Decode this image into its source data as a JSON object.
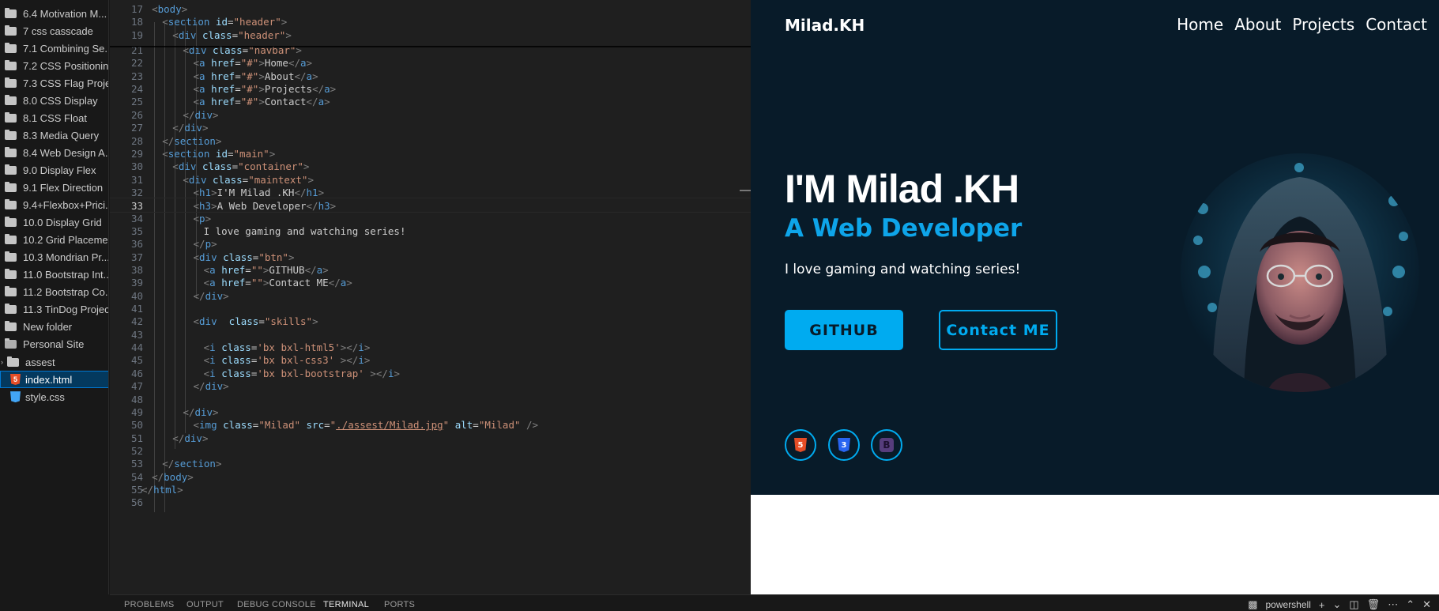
{
  "explorer": {
    "items": [
      {
        "label": "6.4 Motivation M...",
        "kind": "folder"
      },
      {
        "label": "7 css casscade",
        "kind": "folder"
      },
      {
        "label": "7.1 Combining Se...",
        "kind": "folder"
      },
      {
        "label": "7.2 CSS Positioning",
        "kind": "folder"
      },
      {
        "label": "7.3 CSS Flag Project",
        "kind": "folder"
      },
      {
        "label": "8.0 CSS Display",
        "kind": "folder"
      },
      {
        "label": "8.1 CSS Float",
        "kind": "folder"
      },
      {
        "label": "8.3 Media Query",
        "kind": "folder"
      },
      {
        "label": "8.4 Web Design A...",
        "kind": "folder"
      },
      {
        "label": "9.0 Display Flex",
        "kind": "folder"
      },
      {
        "label": "9.1 Flex Direction",
        "kind": "folder"
      },
      {
        "label": "9.4+Flexbox+Prici...",
        "kind": "folder"
      },
      {
        "label": "10.0 Display Grid",
        "kind": "folder"
      },
      {
        "label": "10.2 Grid Placeme...",
        "kind": "folder"
      },
      {
        "label": "10.3 Mondrian Pr...",
        "kind": "folder"
      },
      {
        "label": "11.0 Bootstrap Int...",
        "kind": "folder"
      },
      {
        "label": "11.2 Bootstrap Co...",
        "kind": "folder"
      },
      {
        "label": "11.3 TinDog Project",
        "kind": "folder"
      },
      {
        "label": "New folder",
        "kind": "folder"
      },
      {
        "label": "Personal Site",
        "kind": "folder-open"
      },
      {
        "label": "assest",
        "kind": "subfolder"
      },
      {
        "label": "index.html",
        "kind": "html-file",
        "selected": true
      },
      {
        "label": "style.css",
        "kind": "css-file"
      }
    ]
  },
  "editor": {
    "active_line": 33,
    "lines": [
      {
        "n": "17",
        "indent": 1,
        "tokens": [
          [
            "p",
            "<"
          ],
          [
            "t",
            "body"
          ],
          [
            "p",
            ">"
          ]
        ]
      },
      {
        "n": "18",
        "indent": 2,
        "tokens": [
          [
            "p",
            "<"
          ],
          [
            "t",
            "section"
          ],
          [
            "x",
            " "
          ],
          [
            "a",
            "id"
          ],
          [
            "x",
            "="
          ],
          [
            "s",
            "\"header\""
          ],
          [
            "p",
            ">"
          ]
        ]
      },
      {
        "n": "19",
        "indent": 3,
        "tokens": [
          [
            "p",
            "<"
          ],
          [
            "t",
            "div"
          ],
          [
            "x",
            " "
          ],
          [
            "a",
            "class"
          ],
          [
            "x",
            "="
          ],
          [
            "s",
            "\"header\""
          ],
          [
            "p",
            ">"
          ]
        ]
      },
      {
        "n": "21",
        "indent": 4,
        "tokens": [
          [
            "p",
            "<"
          ],
          [
            "t",
            "div"
          ],
          [
            "x",
            " "
          ],
          [
            "a",
            "class"
          ],
          [
            "x",
            "="
          ],
          [
            "s",
            "\"navbar\""
          ],
          [
            "p",
            ">"
          ]
        ]
      },
      {
        "n": "22",
        "indent": 5,
        "tokens": [
          [
            "p",
            "<"
          ],
          [
            "t",
            "a"
          ],
          [
            "x",
            " "
          ],
          [
            "a",
            "href"
          ],
          [
            "x",
            "="
          ],
          [
            "s",
            "\"#\""
          ],
          [
            "p",
            ">"
          ],
          [
            "x",
            "Home"
          ],
          [
            "p",
            "</"
          ],
          [
            "t",
            "a"
          ],
          [
            "p",
            ">"
          ]
        ]
      },
      {
        "n": "23",
        "indent": 5,
        "tokens": [
          [
            "p",
            "<"
          ],
          [
            "t",
            "a"
          ],
          [
            "x",
            " "
          ],
          [
            "a",
            "href"
          ],
          [
            "x",
            "="
          ],
          [
            "s",
            "\"#\""
          ],
          [
            "p",
            ">"
          ],
          [
            "x",
            "About"
          ],
          [
            "p",
            "</"
          ],
          [
            "t",
            "a"
          ],
          [
            "p",
            ">"
          ]
        ]
      },
      {
        "n": "24",
        "indent": 5,
        "tokens": [
          [
            "p",
            "<"
          ],
          [
            "t",
            "a"
          ],
          [
            "x",
            " "
          ],
          [
            "a",
            "href"
          ],
          [
            "x",
            "="
          ],
          [
            "s",
            "\"#\""
          ],
          [
            "p",
            ">"
          ],
          [
            "x",
            "Projects"
          ],
          [
            "p",
            "</"
          ],
          [
            "t",
            "a"
          ],
          [
            "p",
            ">"
          ]
        ]
      },
      {
        "n": "25",
        "indent": 5,
        "tokens": [
          [
            "p",
            "<"
          ],
          [
            "t",
            "a"
          ],
          [
            "x",
            " "
          ],
          [
            "a",
            "href"
          ],
          [
            "x",
            "="
          ],
          [
            "s",
            "\"#\""
          ],
          [
            "p",
            ">"
          ],
          [
            "x",
            "Contact"
          ],
          [
            "p",
            "</"
          ],
          [
            "t",
            "a"
          ],
          [
            "p",
            ">"
          ]
        ]
      },
      {
        "n": "26",
        "indent": 4,
        "tokens": [
          [
            "p",
            "</"
          ],
          [
            "t",
            "div"
          ],
          [
            "p",
            ">"
          ]
        ]
      },
      {
        "n": "27",
        "indent": 3,
        "tokens": [
          [
            "p",
            "</"
          ],
          [
            "t",
            "div"
          ],
          [
            "p",
            ">"
          ]
        ]
      },
      {
        "n": "28",
        "indent": 2,
        "tokens": [
          [
            "p",
            "</"
          ],
          [
            "t",
            "section"
          ],
          [
            "p",
            ">"
          ]
        ]
      },
      {
        "n": "29",
        "indent": 2,
        "tokens": [
          [
            "p",
            "<"
          ],
          [
            "t",
            "section"
          ],
          [
            "x",
            " "
          ],
          [
            "a",
            "id"
          ],
          [
            "x",
            "="
          ],
          [
            "s",
            "\"main\""
          ],
          [
            "p",
            ">"
          ]
        ]
      },
      {
        "n": "30",
        "indent": 3,
        "tokens": [
          [
            "p",
            "<"
          ],
          [
            "t",
            "div"
          ],
          [
            "x",
            " "
          ],
          [
            "a",
            "class"
          ],
          [
            "x",
            "="
          ],
          [
            "s",
            "\"container\""
          ],
          [
            "p",
            ">"
          ]
        ]
      },
      {
        "n": "31",
        "indent": 4,
        "tokens": [
          [
            "p",
            "<"
          ],
          [
            "t",
            "div"
          ],
          [
            "x",
            " "
          ],
          [
            "a",
            "class"
          ],
          [
            "x",
            "="
          ],
          [
            "s",
            "\"maintext\""
          ],
          [
            "p",
            ">"
          ]
        ]
      },
      {
        "n": "32",
        "indent": 5,
        "tokens": [
          [
            "p",
            "<"
          ],
          [
            "t",
            "h1"
          ],
          [
            "p",
            ">"
          ],
          [
            "x",
            "I'M Milad .KH"
          ],
          [
            "p",
            "</"
          ],
          [
            "t",
            "h1"
          ],
          [
            "p",
            ">"
          ]
        ]
      },
      {
        "n": "33",
        "indent": 5,
        "tokens": [
          [
            "p",
            "<"
          ],
          [
            "t",
            "h3"
          ],
          [
            "p",
            ">"
          ],
          [
            "x",
            "A Web Developer"
          ],
          [
            "p",
            "</"
          ],
          [
            "t",
            "h3"
          ],
          [
            "p",
            ">"
          ]
        ]
      },
      {
        "n": "34",
        "indent": 5,
        "tokens": [
          [
            "p",
            "<"
          ],
          [
            "t",
            "p"
          ],
          [
            "p",
            ">"
          ]
        ]
      },
      {
        "n": "35",
        "indent": 6,
        "tokens": [
          [
            "x",
            "I love gaming and watching series!"
          ]
        ]
      },
      {
        "n": "36",
        "indent": 5,
        "tokens": [
          [
            "p",
            "</"
          ],
          [
            "t",
            "p"
          ],
          [
            "p",
            ">"
          ]
        ]
      },
      {
        "n": "37",
        "indent": 5,
        "tokens": [
          [
            "p",
            "<"
          ],
          [
            "t",
            "div"
          ],
          [
            "x",
            " "
          ],
          [
            "a",
            "class"
          ],
          [
            "x",
            "="
          ],
          [
            "s",
            "\"btn\""
          ],
          [
            "p",
            ">"
          ]
        ]
      },
      {
        "n": "38",
        "indent": 6,
        "tokens": [
          [
            "p",
            "<"
          ],
          [
            "t",
            "a"
          ],
          [
            "x",
            " "
          ],
          [
            "a",
            "href"
          ],
          [
            "x",
            "="
          ],
          [
            "s",
            "\"\""
          ],
          [
            "p",
            ">"
          ],
          [
            "x",
            "GITHUB"
          ],
          [
            "p",
            "</"
          ],
          [
            "t",
            "a"
          ],
          [
            "p",
            ">"
          ]
        ]
      },
      {
        "n": "39",
        "indent": 6,
        "tokens": [
          [
            "p",
            "<"
          ],
          [
            "t",
            "a"
          ],
          [
            "x",
            " "
          ],
          [
            "a",
            "href"
          ],
          [
            "x",
            "="
          ],
          [
            "s",
            "\"\""
          ],
          [
            "p",
            ">"
          ],
          [
            "x",
            "Contact ME"
          ],
          [
            "p",
            "</"
          ],
          [
            "t",
            "a"
          ],
          [
            "p",
            ">"
          ]
        ]
      },
      {
        "n": "40",
        "indent": 5,
        "tokens": [
          [
            "p",
            "</"
          ],
          [
            "t",
            "div"
          ],
          [
            "p",
            ">"
          ]
        ]
      },
      {
        "n": "41",
        "indent": 0,
        "tokens": []
      },
      {
        "n": "42",
        "indent": 5,
        "tokens": [
          [
            "p",
            "<"
          ],
          [
            "t",
            "div"
          ],
          [
            "x",
            "  "
          ],
          [
            "a",
            "class"
          ],
          [
            "x",
            "="
          ],
          [
            "s",
            "\"skills\""
          ],
          [
            "p",
            ">"
          ]
        ]
      },
      {
        "n": "43",
        "indent": 0,
        "tokens": []
      },
      {
        "n": "44",
        "indent": 6,
        "tokens": [
          [
            "p",
            "<"
          ],
          [
            "t",
            "i"
          ],
          [
            "x",
            " "
          ],
          [
            "a",
            "class"
          ],
          [
            "x",
            "="
          ],
          [
            "s",
            "'bx bxl-html5'"
          ],
          [
            "p",
            "></"
          ],
          [
            "t",
            "i"
          ],
          [
            "p",
            ">"
          ]
        ]
      },
      {
        "n": "45",
        "indent": 6,
        "tokens": [
          [
            "p",
            "<"
          ],
          [
            "t",
            "i"
          ],
          [
            "x",
            " "
          ],
          [
            "a",
            "class"
          ],
          [
            "x",
            "="
          ],
          [
            "s",
            "'bx bxl-css3'"
          ],
          [
            "x",
            " "
          ],
          [
            "p",
            "></"
          ],
          [
            "t",
            "i"
          ],
          [
            "p",
            ">"
          ]
        ]
      },
      {
        "n": "46",
        "indent": 6,
        "tokens": [
          [
            "p",
            "<"
          ],
          [
            "t",
            "i"
          ],
          [
            "x",
            " "
          ],
          [
            "a",
            "class"
          ],
          [
            "x",
            "="
          ],
          [
            "s",
            "'bx bxl-bootstrap'"
          ],
          [
            "x",
            " "
          ],
          [
            "p",
            "></"
          ],
          [
            "t",
            "i"
          ],
          [
            "p",
            ">"
          ]
        ]
      },
      {
        "n": "47",
        "indent": 5,
        "tokens": [
          [
            "p",
            "</"
          ],
          [
            "t",
            "div"
          ],
          [
            "p",
            ">"
          ]
        ]
      },
      {
        "n": "48",
        "indent": 0,
        "tokens": []
      },
      {
        "n": "49",
        "indent": 4,
        "tokens": [
          [
            "p",
            "</"
          ],
          [
            "t",
            "div"
          ],
          [
            "p",
            ">"
          ]
        ]
      },
      {
        "n": "50",
        "indent": 5,
        "tokens": [
          [
            "p",
            "<"
          ],
          [
            "t",
            "img"
          ],
          [
            "x",
            " "
          ],
          [
            "a",
            "class"
          ],
          [
            "x",
            "="
          ],
          [
            "s",
            "\"Milad\""
          ],
          [
            "x",
            " "
          ],
          [
            "a",
            "src"
          ],
          [
            "x",
            "="
          ],
          [
            "s",
            "\""
          ],
          [
            "su",
            "./assest/Milad.jpg"
          ],
          [
            "s",
            "\""
          ],
          [
            "x",
            " "
          ],
          [
            "a",
            "alt"
          ],
          [
            "x",
            "="
          ],
          [
            "s",
            "\"Milad\""
          ],
          [
            "x",
            " "
          ],
          [
            "p",
            "/>"
          ]
        ]
      },
      {
        "n": "51",
        "indent": 3,
        "tokens": [
          [
            "p",
            "</"
          ],
          [
            "t",
            "div"
          ],
          [
            "p",
            ">"
          ]
        ]
      },
      {
        "n": "52",
        "indent": 0,
        "tokens": []
      },
      {
        "n": "53",
        "indent": 2,
        "tokens": [
          [
            "p",
            "</"
          ],
          [
            "t",
            "section"
          ],
          [
            "p",
            ">"
          ]
        ]
      },
      {
        "n": "54",
        "indent": 1,
        "tokens": [
          [
            "p",
            "</"
          ],
          [
            "t",
            "body"
          ],
          [
            "p",
            ">"
          ]
        ]
      },
      {
        "n": "55",
        "indent": 0,
        "tokens": [
          [
            "p",
            "</"
          ],
          [
            "t",
            "html"
          ],
          [
            "p",
            ">"
          ]
        ]
      },
      {
        "n": "56",
        "indent": 0,
        "tokens": []
      }
    ]
  },
  "preview": {
    "logo": "Milad.KH",
    "nav": [
      "Home",
      "About",
      "Projects",
      "Contact"
    ],
    "title": "I'M Milad .KH",
    "subtitle": "A Web Developer",
    "text": "I love gaming and watching series!",
    "btn_github": "GITHUB",
    "btn_contact": "Contact ME",
    "skills": [
      {
        "icon": "html5-icon",
        "glyph": "5",
        "color": "#e44d26"
      },
      {
        "icon": "css3-icon",
        "glyph": "3",
        "color": "#2965f1"
      },
      {
        "icon": "bootstrap-icon",
        "glyph": "B",
        "color": "#563d7c"
      }
    ],
    "colors": {
      "bg": "#081b29",
      "accent": "#00abf0",
      "subtitle": "#0ea5e9"
    }
  },
  "panel": {
    "tabs": [
      "PROBLEMS",
      "OUTPUT",
      "DEBUG CONSOLE",
      "TERMINAL",
      "PORTS"
    ],
    "active_tab": "TERMINAL",
    "terminal_name": "powershell"
  }
}
